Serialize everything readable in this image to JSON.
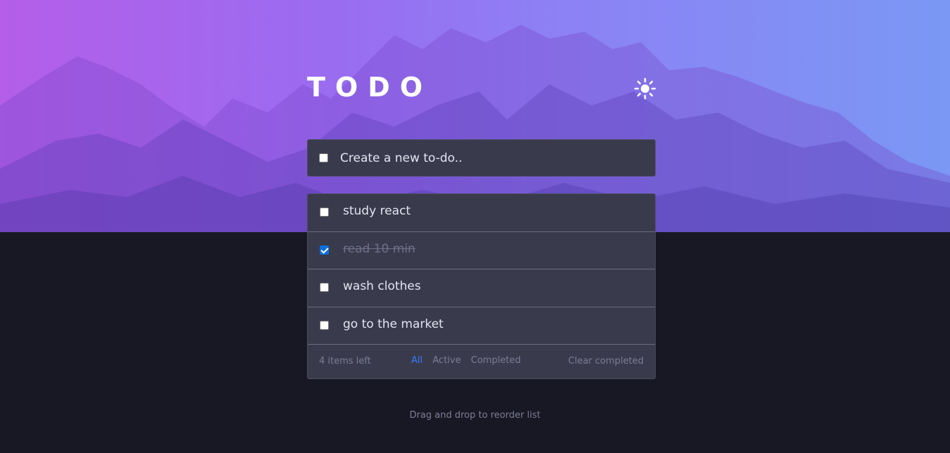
{
  "app": {
    "title": "TODO",
    "theme_toggle_icon": "sun-icon",
    "colors": {
      "background": "#181824",
      "card": "#393a4c",
      "accent": "#3a7bfd",
      "text": "#e4e5f1",
      "muted": "#7d7e94"
    }
  },
  "new_todo": {
    "placeholder": "Create a new to-do.."
  },
  "todos": [
    {
      "text": "study react",
      "completed": false
    },
    {
      "text": "read 10 min",
      "completed": true
    },
    {
      "text": "wash clothes",
      "completed": false
    },
    {
      "text": "go to the market",
      "completed": false
    }
  ],
  "footer": {
    "items_left": "4 items left",
    "filters": [
      "All",
      "Active",
      "Completed"
    ],
    "active_filter": "All",
    "clear_label": "Clear completed"
  },
  "hint": "Drag and drop to reorder list"
}
